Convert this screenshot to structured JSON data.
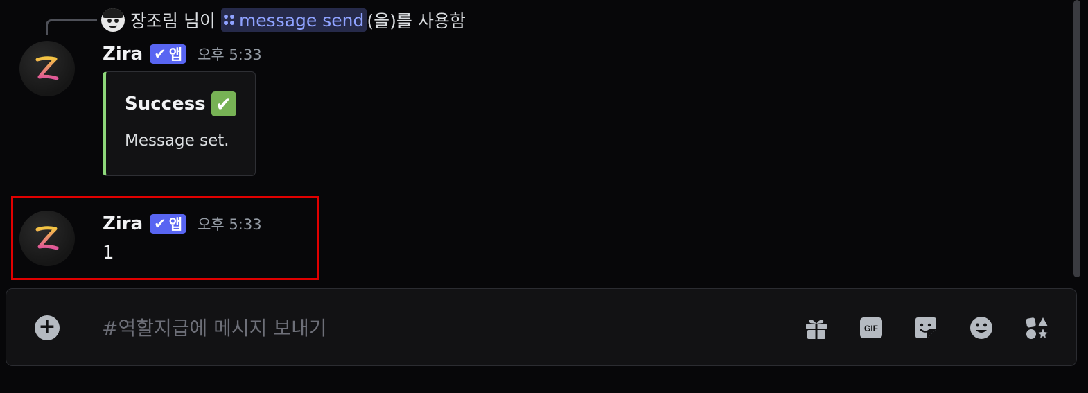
{
  "reply": {
    "user": "장조림 님이",
    "command": "message send",
    "suffix": "(을)를 사용함"
  },
  "messages": [
    {
      "username": "Zira",
      "badge": "앱",
      "timestamp": "오후 5:33",
      "embed": {
        "title": "Success",
        "title_emoji": "✔",
        "description": "Message set.",
        "accent_color": "#8dd77a"
      }
    },
    {
      "username": "Zira",
      "badge": "앱",
      "timestamp": "오후 5:33",
      "content": "1"
    }
  ],
  "composer": {
    "placeholder": "#역할지급에 메시지 보내기",
    "tools": [
      "gift-icon",
      "gif-icon",
      "sticker-icon",
      "emoji-icon",
      "apps-icon"
    ],
    "gif_label": "GIF"
  },
  "colors": {
    "badge": "#5865f2",
    "highlight": "#e00000",
    "mention_bg": "#262a4a",
    "mention_text": "#8fa2ff"
  }
}
